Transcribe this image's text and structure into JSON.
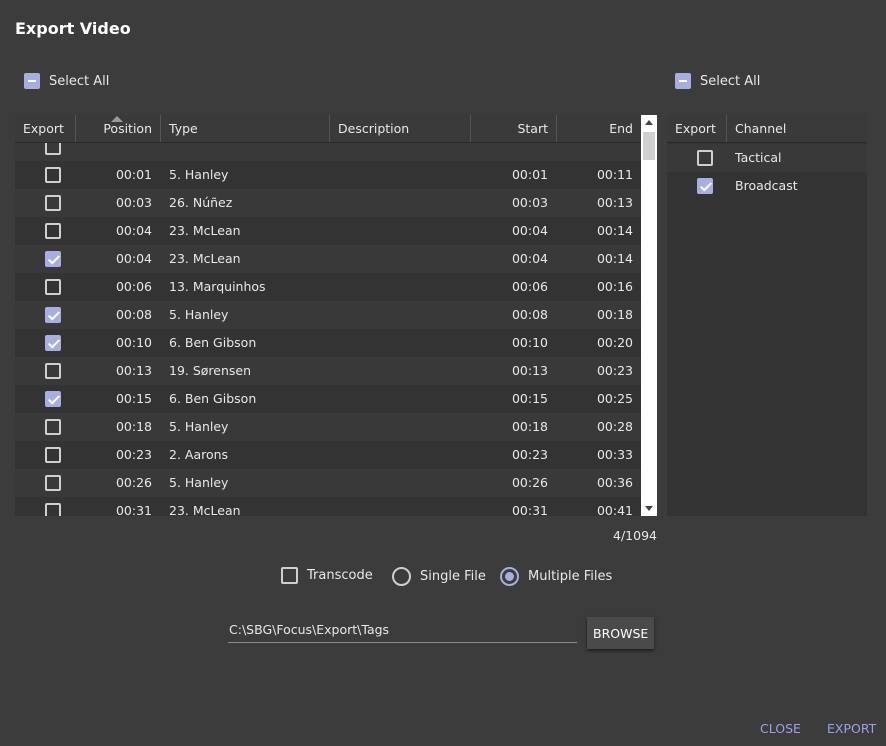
{
  "dialog": {
    "title": "Export Video"
  },
  "select_all_left": {
    "label": "Select All",
    "state": "partial"
  },
  "select_all_right": {
    "label": "Select All",
    "state": "partial"
  },
  "table": {
    "columns": [
      "Export",
      "Position",
      "Type",
      "Description",
      "Start",
      "End"
    ],
    "sort_column": "Position",
    "rows": [
      {
        "checked": false,
        "position": "",
        "type": "",
        "description": "",
        "start": "",
        "end": ""
      },
      {
        "checked": false,
        "position": "00:01",
        "type": "5. Hanley",
        "description": "",
        "start": "00:01",
        "end": "00:11"
      },
      {
        "checked": false,
        "position": "00:03",
        "type": "26. Núñez",
        "description": "",
        "start": "00:03",
        "end": "00:13"
      },
      {
        "checked": false,
        "position": "00:04",
        "type": "23. McLean",
        "description": "",
        "start": "00:04",
        "end": "00:14"
      },
      {
        "checked": true,
        "position": "00:04",
        "type": "23. McLean",
        "description": "",
        "start": "00:04",
        "end": "00:14"
      },
      {
        "checked": false,
        "position": "00:06",
        "type": "13. Marquinhos",
        "description": "",
        "start": "00:06",
        "end": "00:16"
      },
      {
        "checked": true,
        "position": "00:08",
        "type": "5. Hanley",
        "description": "",
        "start": "00:08",
        "end": "00:18"
      },
      {
        "checked": true,
        "position": "00:10",
        "type": "6. Ben Gibson",
        "description": "",
        "start": "00:10",
        "end": "00:20"
      },
      {
        "checked": false,
        "position": "00:13",
        "type": "19. Sørensen",
        "description": "",
        "start": "00:13",
        "end": "00:23"
      },
      {
        "checked": true,
        "position": "00:15",
        "type": "6. Ben Gibson",
        "description": "",
        "start": "00:15",
        "end": "00:25"
      },
      {
        "checked": false,
        "position": "00:18",
        "type": "5. Hanley",
        "description": "",
        "start": "00:18",
        "end": "00:28"
      },
      {
        "checked": false,
        "position": "00:23",
        "type": "2. Aarons",
        "description": "",
        "start": "00:23",
        "end": "00:33"
      },
      {
        "checked": false,
        "position": "00:26",
        "type": "5. Hanley",
        "description": "",
        "start": "00:26",
        "end": "00:36"
      },
      {
        "checked": false,
        "position": "00:31",
        "type": "23. McLean",
        "description": "",
        "start": "00:31",
        "end": "00:41"
      }
    ]
  },
  "count": "4/1094",
  "channels": {
    "columns": [
      "Export",
      "Channel"
    ],
    "rows": [
      {
        "checked": false,
        "name": "Tactical"
      },
      {
        "checked": true,
        "name": "Broadcast"
      }
    ]
  },
  "options": {
    "transcode": {
      "label": "Transcode",
      "checked": false
    },
    "single_file": {
      "label": "Single File",
      "selected": false
    },
    "multiple_files": {
      "label": "Multiple Files",
      "selected": true
    }
  },
  "path": {
    "value": "C:\\SBG\\Focus\\Export\\Tags"
  },
  "browse_label": "BROWSE",
  "actions": {
    "close": "CLOSE",
    "export": "EXPORT"
  },
  "colors": {
    "background": "#3c3c3c",
    "accent": "#a8aee0",
    "action_text": "#9aa0e6"
  }
}
